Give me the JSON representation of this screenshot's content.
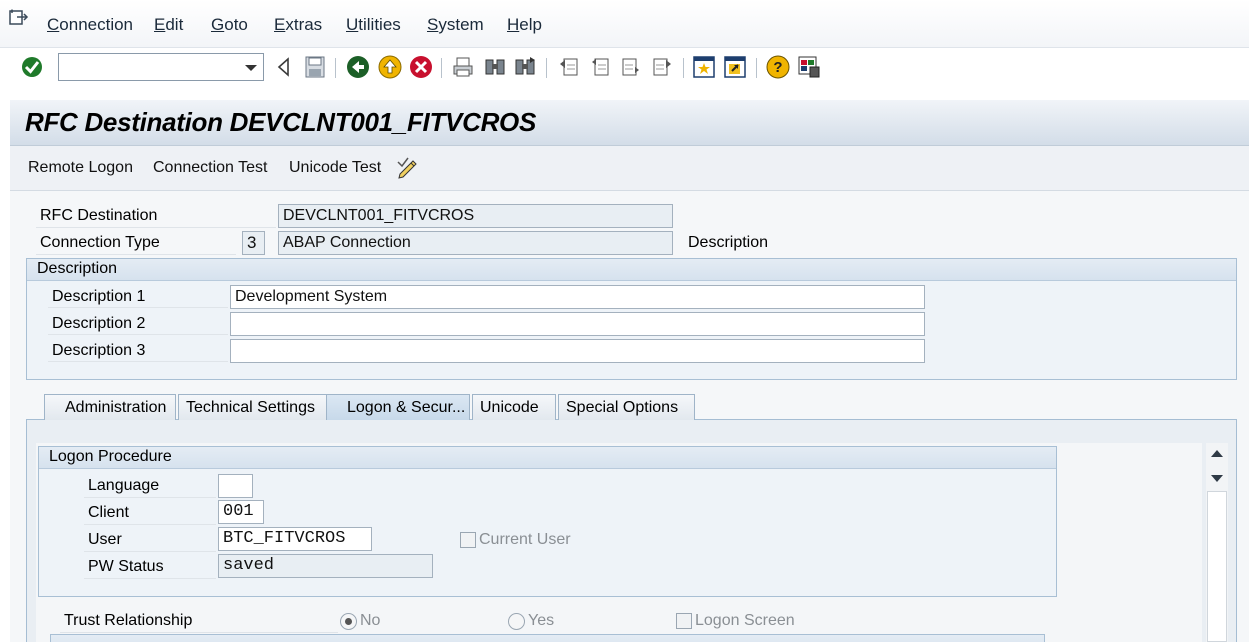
{
  "menu": {
    "items": [
      {
        "label": "Connection"
      },
      {
        "label": "Edit"
      },
      {
        "label": "Goto"
      },
      {
        "label": "Extras"
      },
      {
        "label": "Utilities"
      },
      {
        "label": "System"
      },
      {
        "label": "Help"
      }
    ]
  },
  "toolbar": {
    "command_value": "",
    "icons": [
      "enter-icon",
      "back-arrow-icon",
      "save-icon",
      "back-icon",
      "exit-icon",
      "cancel-icon",
      "print-icon",
      "find-icon",
      "find-next-icon",
      "first-page-icon",
      "previous-page-icon",
      "next-page-icon",
      "last-page-icon",
      "create-session-icon",
      "shortcut-icon",
      "help-icon",
      "customize-layout-icon"
    ]
  },
  "title": "RFC Destination DEVCLNT001_FITVCROS",
  "app_toolbar": {
    "remote_logon": "Remote Logon",
    "connection_test": "Connection Test",
    "unicode_test": "Unicode Test"
  },
  "header": {
    "rfc_destination_label": "RFC Destination",
    "rfc_destination_value": "DEVCLNT001_FITVCROS",
    "connection_type_label": "Connection Type",
    "connection_type_code": "3",
    "connection_type_value": "ABAP Connection",
    "description_link": "Description"
  },
  "description_group": {
    "title": "Description",
    "desc1_label": "Description 1",
    "desc1_value": "Development System",
    "desc2_label": "Description 2",
    "desc2_value": "",
    "desc3_label": "Description 3",
    "desc3_value": ""
  },
  "tabs": [
    {
      "label": "Administration",
      "active": false
    },
    {
      "label": "Technical Settings",
      "active": false
    },
    {
      "label": "Logon & Secur...",
      "active": true
    },
    {
      "label": "Unicode",
      "active": false
    },
    {
      "label": "Special Options",
      "active": false
    }
  ],
  "logon_procedure": {
    "title": "Logon Procedure",
    "language_label": "Language",
    "language_value": "",
    "client_label": "Client",
    "client_value": "001",
    "user_label": "User",
    "user_value": "BTC_FITVCROS",
    "current_user_label": "Current User",
    "current_user_checked": false,
    "pw_status_label": "PW Status",
    "pw_status_value": "saved"
  },
  "trust": {
    "label": "Trust Relationship",
    "no_label": "No",
    "yes_label": "Yes",
    "selected": "No",
    "logon_screen_label": "Logon Screen",
    "logon_screen_checked": false
  }
}
